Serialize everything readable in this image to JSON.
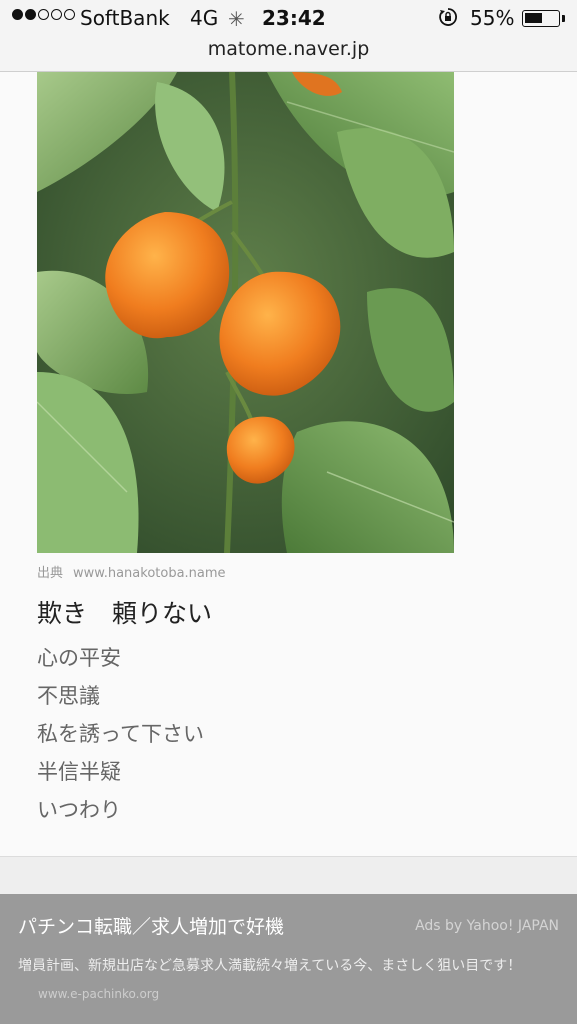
{
  "status_bar": {
    "carrier": "SoftBank",
    "network": "4G",
    "time": "23:42",
    "battery": "55%",
    "battery_level": 0.55,
    "signal_bars": 2,
    "signal_total": 5
  },
  "url_bar": {
    "host": "matome.naver.jp"
  },
  "article": {
    "image_alt": "ほおずき",
    "source_label": "出典",
    "source_url": "www.hanakotoba.name",
    "heading": "欺き　頼りない",
    "meanings": [
      "心の平安",
      "不思議",
      "私を誘って下さい",
      "半信半疑",
      "いつわり"
    ]
  },
  "ad": {
    "title": "パチンコ転職／求人増加で好機",
    "credit": "Ads by Yahoo! JAPAN",
    "body": "増員計画、新規出店など急募求人満載続々増えている今、まさしく狙い目です！",
    "url": "www.e-pachinko.org"
  }
}
